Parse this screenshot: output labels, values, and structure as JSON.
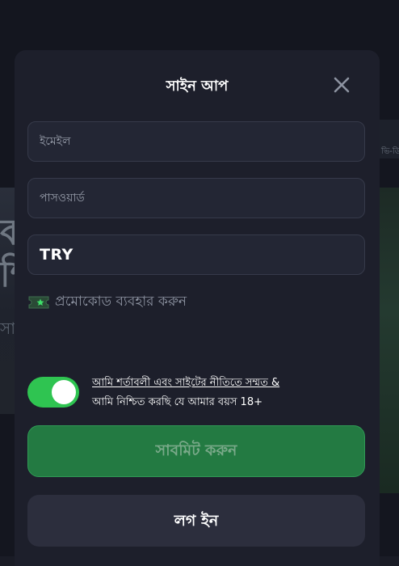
{
  "modal": {
    "title": "সাইন আপ",
    "close_icon": "close-icon"
  },
  "form": {
    "email_placeholder": "ইমেইল",
    "password_placeholder": "পাসওয়ার্ড",
    "currency_value": "TRY"
  },
  "promo": {
    "icon": "ticket-star-icon",
    "label": "প্রমোকোড ব্যবহার করুন"
  },
  "consent": {
    "enabled": true,
    "text_line1": "আমি শর্তাবলী এবং সাইটের নীতিতে সম্মত &",
    "text_line2": "আমি নিশ্চিত করছি যে আমার বয়স 18+"
  },
  "buttons": {
    "submit_label": "সাবমিট করুন",
    "login_label": "লগ ইন"
  },
  "background": {
    "right_caption": "ভি-ডি"
  },
  "colors": {
    "accent_green": "#2fc451",
    "submit_bg": "#237a42",
    "modal_bg": "#1d1f2b"
  }
}
